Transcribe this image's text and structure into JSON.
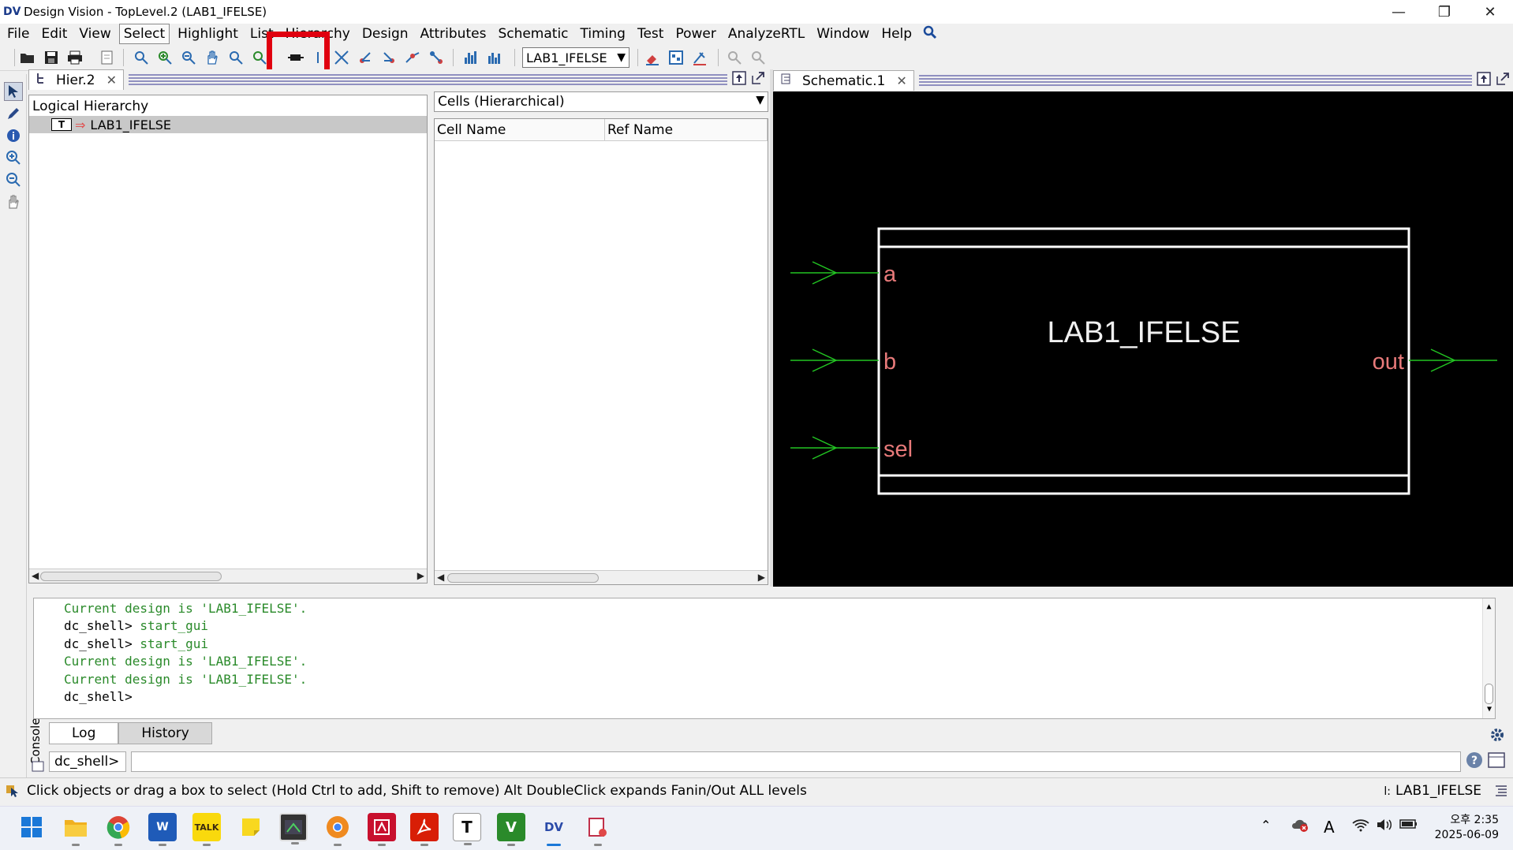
{
  "window": {
    "logo": "DV",
    "title": "Design Vision - TopLevel.2 (LAB1_IFELSE)",
    "minimize": "—",
    "maximize": "❐",
    "close": "✕"
  },
  "menu": {
    "items": [
      "File",
      "Edit",
      "View",
      "Select",
      "Highlight",
      "List",
      "Hierarchy",
      "Design",
      "Attributes",
      "Schematic",
      "Timing",
      "Test",
      "Power",
      "AnalyzeRTL",
      "Window",
      "Help"
    ],
    "active": "Select"
  },
  "toolbar": {
    "design_select": "LAB1_IFELSE",
    "dropdown_arrow": "▼"
  },
  "hier_panel": {
    "tab_label": "Hier.2",
    "tab_close": "✕",
    "tree_header": "Logical Hierarchy",
    "tree_badge": "T",
    "tree_arrow": "⇒",
    "tree_item": "LAB1_IFELSE"
  },
  "cells_panel": {
    "dropdown_label": "Cells (Hierarchical)",
    "dropdown_arrow": "▼",
    "columns": [
      "Cell Name",
      "Ref Name"
    ]
  },
  "schematic_panel": {
    "tab_label": "Schematic.1",
    "tab_close": "✕",
    "block_name": "LAB1_IFELSE",
    "input_ports": [
      "a",
      "b",
      "sel"
    ],
    "output_ports": [
      "out"
    ],
    "colors": {
      "background": "#000000",
      "block_outline": "#ffffff",
      "wire": "#22c422",
      "port_label": "#e87a7a",
      "block_label": "#f0f0f0"
    }
  },
  "console": {
    "lines": [
      {
        "prefix": "",
        "text": "Current design is 'LAB1_IFELSE'."
      },
      {
        "prefix": "dc_shell> ",
        "text": "start_gui"
      },
      {
        "prefix": "dc_shell> ",
        "text": "start_gui"
      },
      {
        "prefix": "",
        "text": "Current design is 'LAB1_IFELSE'."
      },
      {
        "prefix": "",
        "text": "Current design is 'LAB1_IFELSE'."
      },
      {
        "prefix": "dc_shell> ",
        "text": ""
      }
    ],
    "label": "Console",
    "tabs": [
      "Log",
      "History"
    ],
    "active_tab": "Log",
    "prompt": "dc_shell>",
    "command_value": ""
  },
  "status": {
    "message": "Click objects or drag a box to select (Hold Ctrl to add, Shift to remove) Alt DoubleClick expands Fanin/Out ALL levels",
    "current": "LAB1_IFELSE",
    "current_prefix": "l:"
  },
  "taskbar": {
    "time": "오후 2:35",
    "date": "2025-06-09",
    "ime": "A",
    "apps": [
      "start",
      "file-explorer",
      "chrome",
      "word",
      "kakaotalk",
      "sticky-notes",
      "snipping-tool",
      "chrome-canary",
      "app-red",
      "acrobat",
      "typora",
      "vim",
      "design-vision",
      "paint"
    ]
  }
}
